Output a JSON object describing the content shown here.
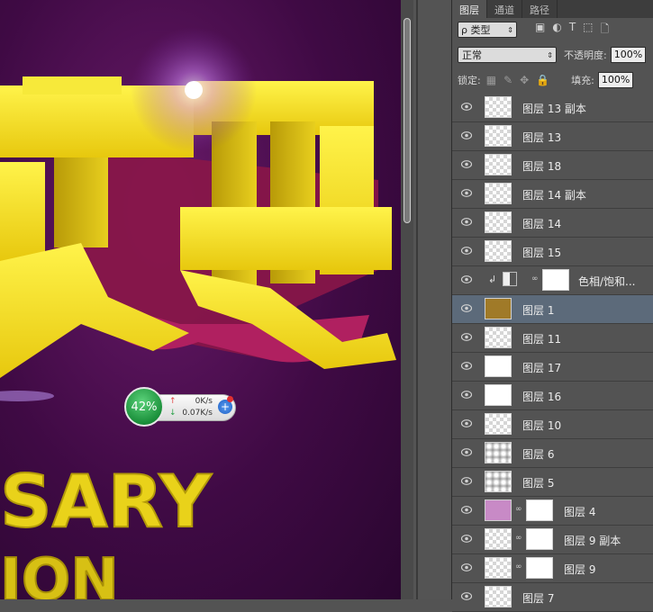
{
  "canvas": {
    "art_text": "SARY",
    "art_text_2": "ION"
  },
  "net_widget": {
    "percent": "42%",
    "upload": "0K/s",
    "download": "0.07K/s"
  },
  "panel": {
    "tabs": [
      {
        "label": "图层",
        "active": true
      },
      {
        "label": "通道",
        "active": false
      },
      {
        "label": "路径",
        "active": false
      }
    ],
    "filter_kind": "ρ 类型",
    "blend_mode": "正常",
    "opacity_label": "不透明度:",
    "opacity_value": "100%",
    "lock_label": "锁定:",
    "fill_label": "填充:",
    "fill_value": "100%"
  },
  "layers": [
    {
      "name": "图层 13 副本",
      "thumb": "checker"
    },
    {
      "name": "图层 13",
      "thumb": "checker"
    },
    {
      "name": "图层 18",
      "thumb": "checker"
    },
    {
      "name": "图层 14 副本",
      "thumb": "checker"
    },
    {
      "name": "图层 14",
      "thumb": "checker"
    },
    {
      "name": "图层 15",
      "thumb": "checker"
    },
    {
      "name": "色相/饱和...",
      "thumb": "adjustment"
    },
    {
      "name": "图层 1",
      "thumb": "checker",
      "selected": true
    },
    {
      "name": "图层 11",
      "thumb": "checker"
    },
    {
      "name": "图层 17",
      "thumb": "white"
    },
    {
      "name": "图层 16",
      "thumb": "white"
    },
    {
      "name": "图层 10",
      "thumb": "checker"
    },
    {
      "name": "图层 6",
      "thumb": "fade"
    },
    {
      "name": "图层 5",
      "thumb": "fade"
    },
    {
      "name": "图层 4",
      "thumb": "pink",
      "mask": true
    },
    {
      "name": "图层 9 副本",
      "thumb": "checker",
      "mask": true
    },
    {
      "name": "图层 9",
      "thumb": "checker",
      "mask": true
    },
    {
      "name": "图层 7",
      "thumb": "checker"
    }
  ]
}
